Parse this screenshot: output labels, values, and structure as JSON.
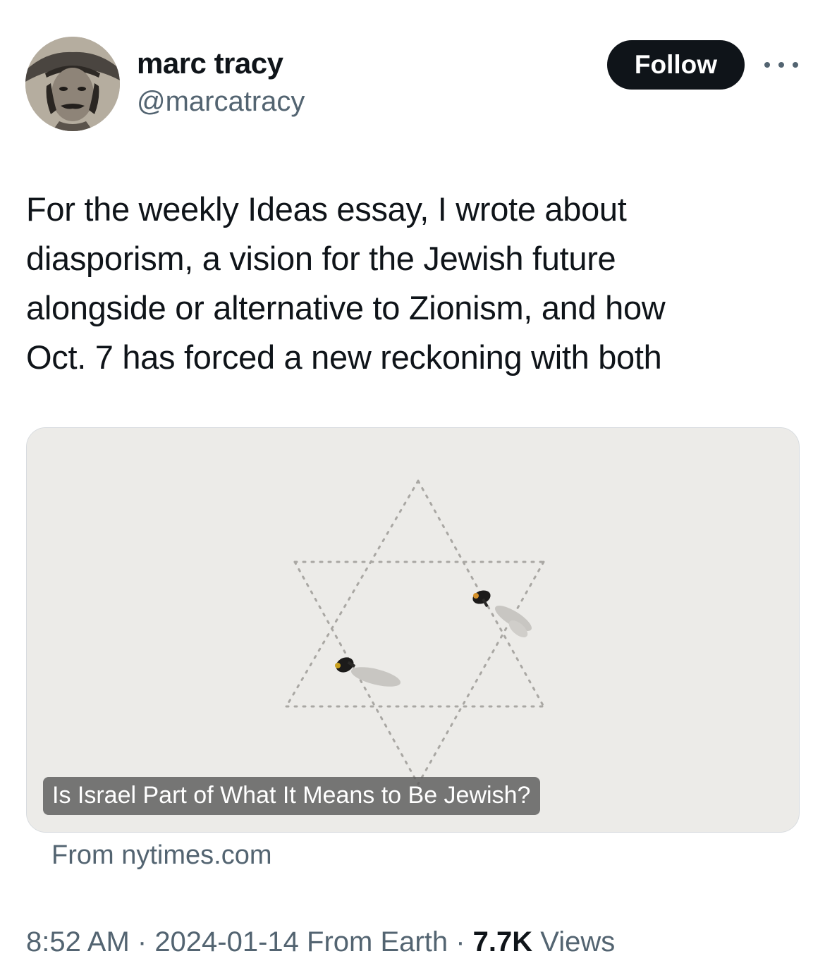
{
  "author": {
    "display_name": "marc tracy",
    "handle": "@marcatracy",
    "avatar": "avatar-photo"
  },
  "actions": {
    "follow_label": "Follow",
    "more_icon": "more-horizontal-icon"
  },
  "tweet": {
    "text": "For the weekly Ideas essay, I wrote about\ndiasporism, a vision for the Jewish future\nalongside or alternative to Zionism, and how\nOct. 7 has forced a new reckoning with both"
  },
  "card": {
    "title": "Is Israel Part of What It Means to Be Jewish?",
    "source": "From nytimes.com",
    "image": "star-of-david-footprints-illustration"
  },
  "meta": {
    "time": "8:52 AM",
    "sep1": " · ",
    "date": "2024-01-14 From Earth",
    "sep2": " · ",
    "views_count": "7.7K",
    "views_label": " Views"
  },
  "colors": {
    "text_primary": "#0f1419",
    "text_secondary": "#536471",
    "follow_bg": "#0f1419",
    "card_bg": "#ecebe8"
  }
}
